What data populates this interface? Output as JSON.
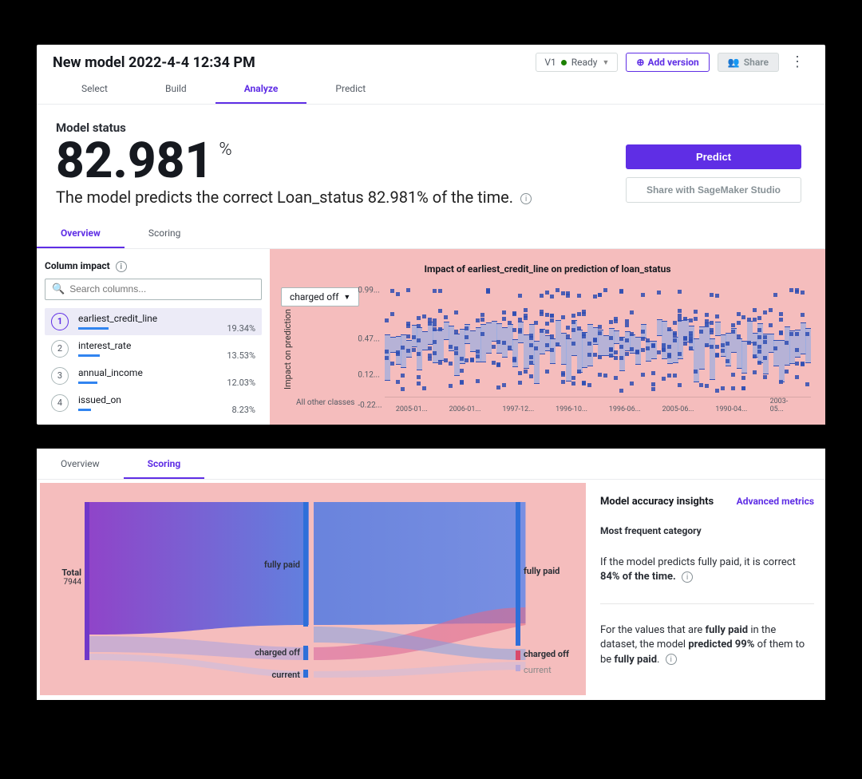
{
  "header": {
    "title": "New model 2022-4-4 12:34 PM",
    "version_label": "V1",
    "status_label": "Ready",
    "add_version_label": "Add version",
    "share_label": "Share"
  },
  "nav_tabs": {
    "select": "Select",
    "build": "Build",
    "analyze": "Analyze",
    "predict": "Predict"
  },
  "status": {
    "heading": "Model status",
    "value": "82.981",
    "unit": "%",
    "description": "The model predicts the correct Loan_status 82.981% of the time.",
    "predict_btn": "Predict",
    "share_btn": "Share with SageMaker Studio"
  },
  "sub_tabs": {
    "overview": "Overview",
    "scoring": "Scoring"
  },
  "column_impact": {
    "heading": "Column impact",
    "search_placeholder": "Search columns...",
    "items": [
      {
        "name": "earliest_credit_line",
        "pct": "19.34%",
        "bar": 38
      },
      {
        "name": "interest_rate",
        "pct": "13.53%",
        "bar": 27
      },
      {
        "name": "annual_income",
        "pct": "12.03%",
        "bar": 24
      },
      {
        "name": "issued_on",
        "pct": "8.23%",
        "bar": 16
      }
    ]
  },
  "chart": {
    "title": "Impact of earliest_credit_line on prediction of loan_status",
    "dropdown_label": "charged off",
    "y_axis_label": "Impact on prediction",
    "other_classes_label": "All other classes",
    "y_ticks": [
      "0.99...",
      "0.47...",
      "0.12...",
      "-0.22..."
    ],
    "x_ticks": [
      "2005-01...",
      "2006-01...",
      "1997-12...",
      "1996-10...",
      "1996-06...",
      "2005-06...",
      "1990-04...",
      "2003-05..."
    ]
  },
  "chart_data": {
    "type": "scatter",
    "title": "Impact of earliest_credit_line on prediction of loan_status",
    "xlabel": "earliest_credit_line",
    "ylabel": "Impact on prediction",
    "ylim": [
      -0.22,
      0.99
    ],
    "x_categories": [
      "2005-01",
      "2006-01",
      "1997-12",
      "1996-10",
      "1996-06",
      "2005-06",
      "1990-04",
      "2003-05"
    ],
    "note": "Dense box/strip plot of SHAP-like impact values per earliest_credit_line; values shown as distribution between approx -0.22 and 0.99 with median band near 0.4-0.5."
  },
  "scoring": {
    "total_label": "Total",
    "total_value": "7944",
    "mid_labels": {
      "fully_paid": "fully paid",
      "charged_off": "charged off",
      "current": "current"
    },
    "right_labels": {
      "fully_paid": "fully paid",
      "charged_off": "charged off",
      "current": "current"
    }
  },
  "insights": {
    "heading": "Model accuracy insights",
    "advanced_link": "Advanced metrics",
    "subheading": "Most frequent category",
    "text1_pre": "If the model predicts fully paid, it is correct ",
    "text1_bold": "84% of the time.",
    "text2_pre": "For the values that are ",
    "text2_b1": "fully paid",
    "text2_mid": " in the dataset, the model ",
    "text2_b2": "predicted 99%",
    "text2_mid2": " of them to be ",
    "text2_b3": "fully paid"
  }
}
